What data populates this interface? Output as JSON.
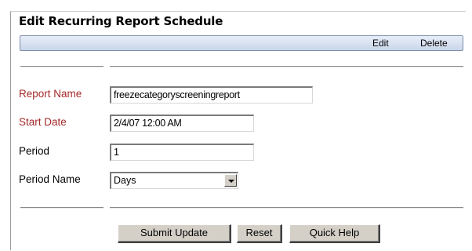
{
  "page": {
    "title": "Edit Recurring Report Schedule"
  },
  "toolbar": {
    "edit_label": "Edit",
    "delete_label": "Delete"
  },
  "form": {
    "report_name": {
      "label": "Report Name",
      "value": "freezecategoryscreeningreport",
      "required": true
    },
    "start_date": {
      "label": "Start Date",
      "value": "2/4/07 12:00 AM",
      "required": true
    },
    "period": {
      "label": "Period",
      "value": "1",
      "required": false
    },
    "period_name": {
      "label": "Period Name",
      "value": "Days",
      "required": false
    }
  },
  "actions": {
    "submit_label": "Submit Update",
    "reset_label": "Reset",
    "help_label": "Quick Help"
  },
  "colors": {
    "required_label": "#a52a2a",
    "toolbar_top": "#e7eef8",
    "toolbar_bottom": "#c9d6ea",
    "button_face": "#d4d0c8"
  }
}
